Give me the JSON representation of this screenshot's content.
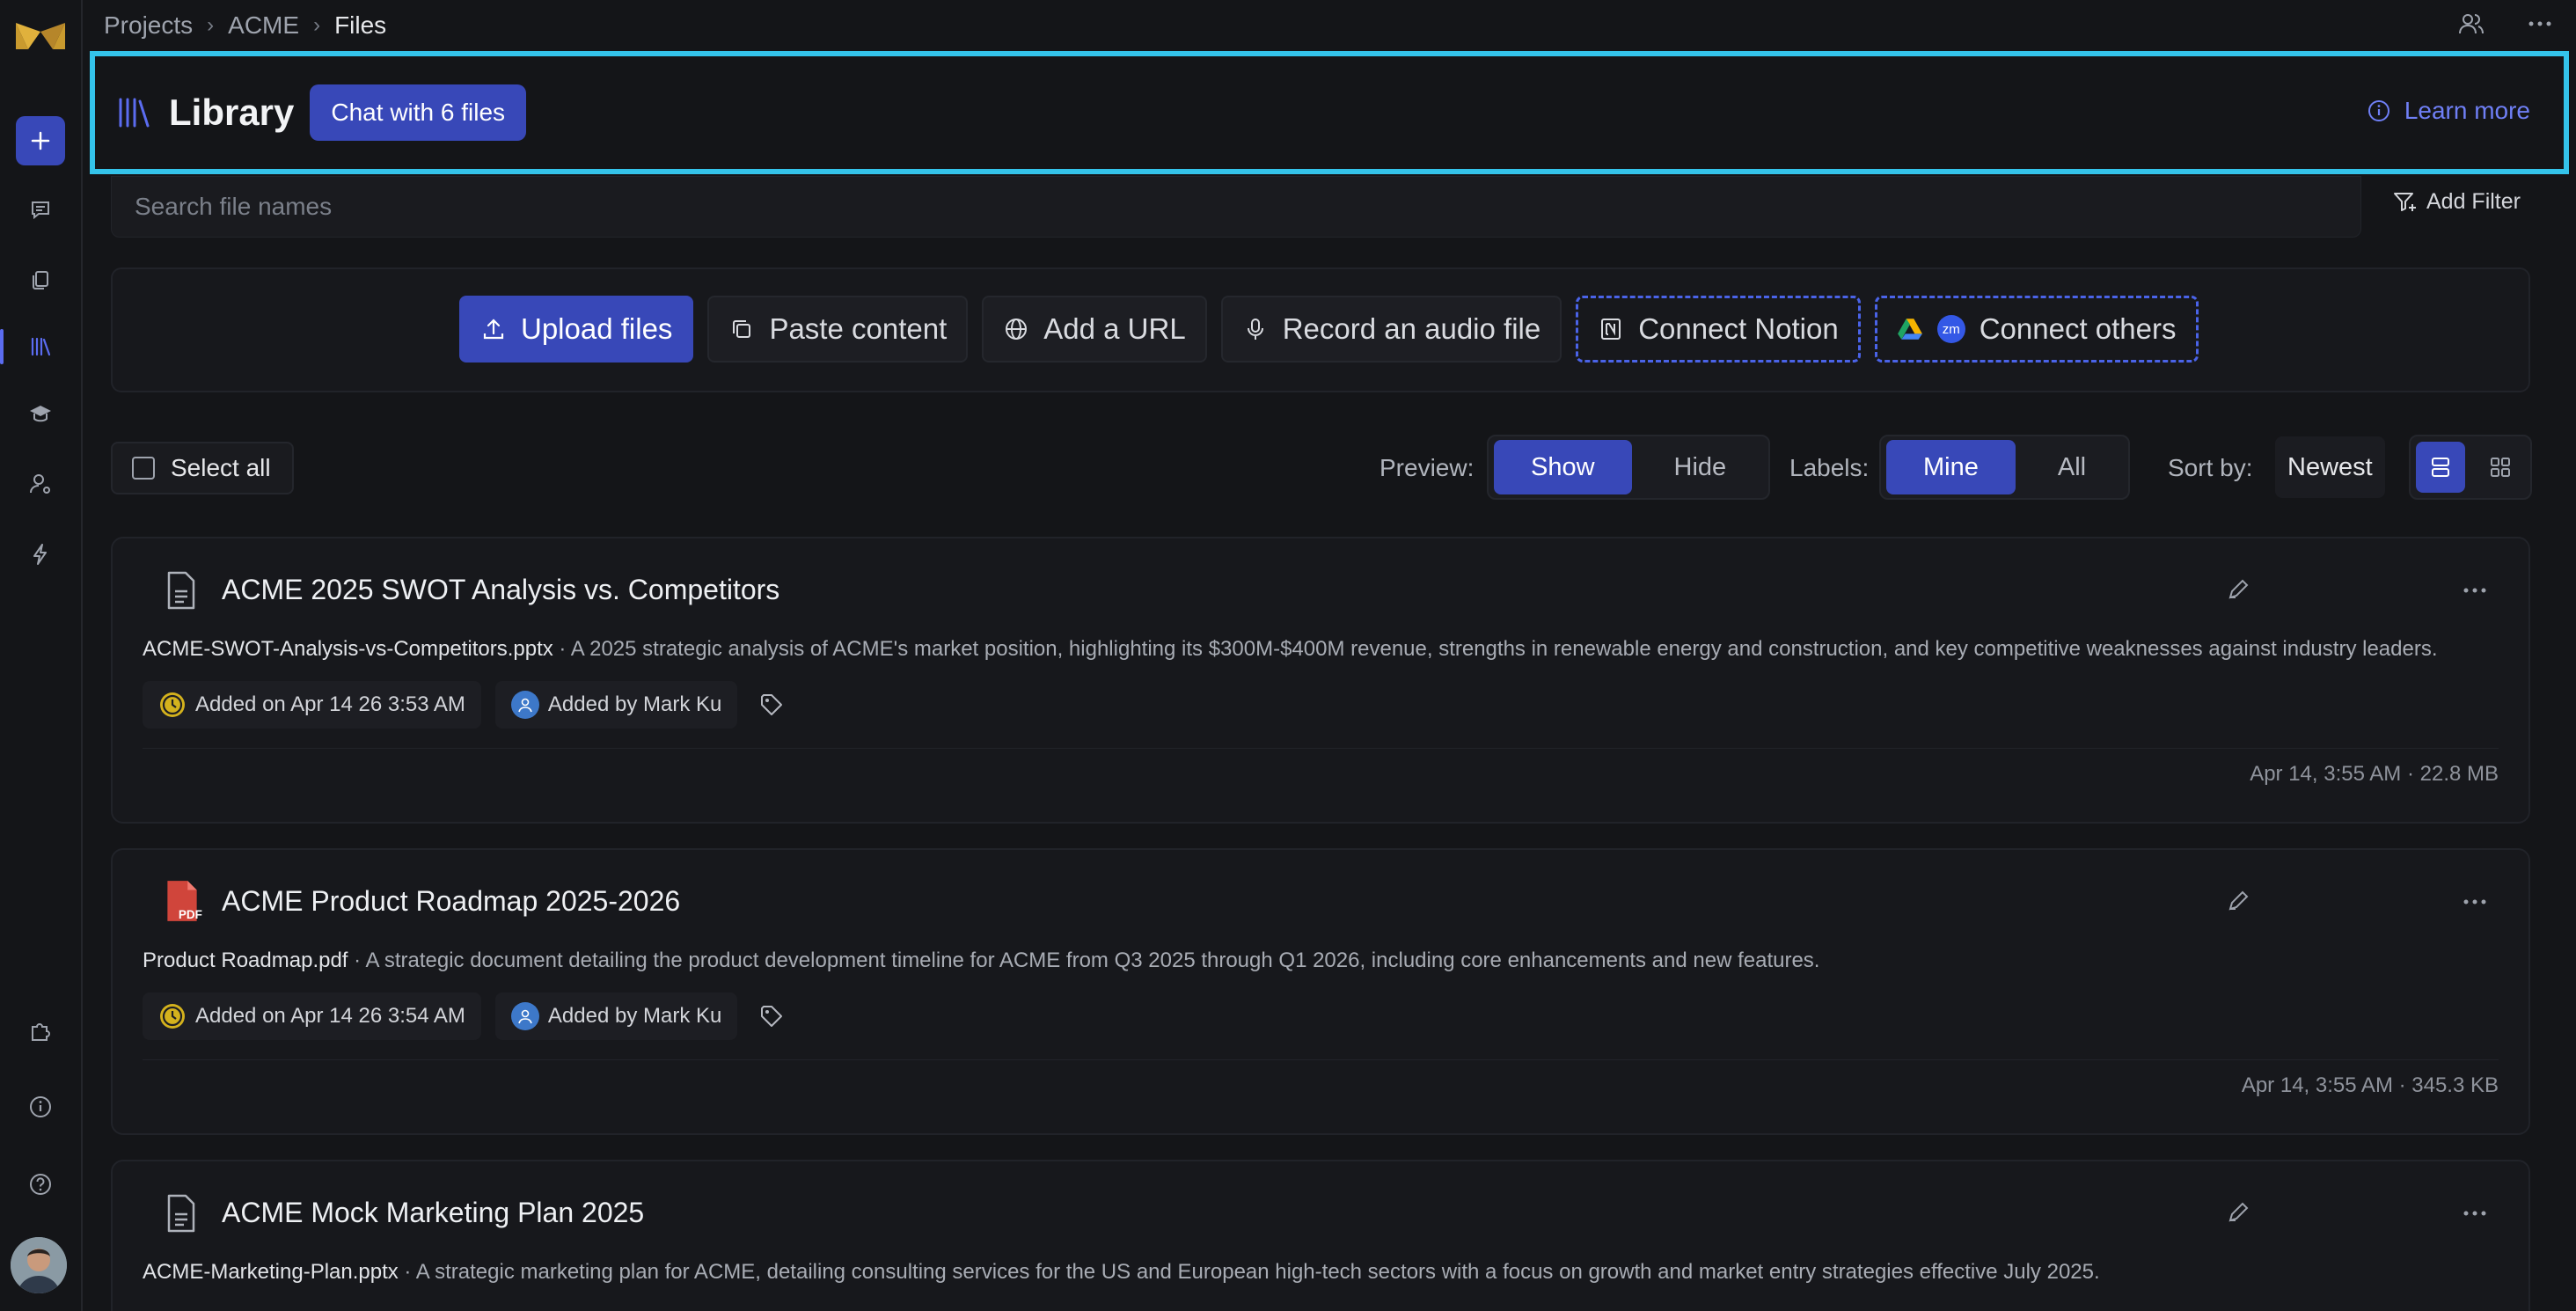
{
  "breadcrumb": {
    "items": [
      "Projects",
      "ACME",
      "Files"
    ]
  },
  "library": {
    "title": "Library",
    "chat_button": "Chat with 6 files",
    "learn_more": "Learn more"
  },
  "search": {
    "placeholder": "Search file names"
  },
  "filter": {
    "add_filter": "Add Filter"
  },
  "upload_actions": {
    "upload": "Upload files",
    "paste": "Paste content",
    "url": "Add a URL",
    "audio": "Record an audio file",
    "notion": "Connect Notion",
    "others": "Connect others"
  },
  "controls": {
    "select_all": "Select all",
    "preview_label": "Preview:",
    "preview_options": [
      "Show",
      "Hide"
    ],
    "preview_selected": "Show",
    "labels_label": "Labels:",
    "labels_options": [
      "Mine",
      "All"
    ],
    "labels_selected": "Mine",
    "sort_label": "Sort by:",
    "sort_value": "Newest",
    "view_selected": "list"
  },
  "files": [
    {
      "title": "ACME 2025 SWOT Analysis vs. Competitors",
      "filename": "ACME-SWOT-Analysis-vs-Competitors.pptx",
      "description": " · A 2025 strategic analysis of ACME's market position, highlighting its $300M-$400M revenue, strengths in renewable energy and construction, and key competitive weaknesses against industry leaders.",
      "added_on": "Added on Apr 14 26 3:53 AM",
      "added_by": "Added by Mark Ku",
      "meta": "Apr 14, 3:55 AM · 22.8 MB",
      "icon": "document-icon"
    },
    {
      "title": "ACME Product Roadmap 2025-2026",
      "filename": "Product Roadmap.pdf",
      "description": " · A strategic document detailing the product development timeline for ACME from Q3 2025 through Q1 2026, including core enhancements and new features.",
      "added_on": "Added on Apr 14 26 3:54 AM",
      "added_by": "Added by Mark Ku",
      "meta": "Apr 14, 3:55 AM · 345.3 KB",
      "icon": "pdf-icon"
    },
    {
      "title": "ACME Mock Marketing Plan 2025",
      "filename": "ACME-Marketing-Plan.pptx",
      "description": " · A strategic marketing plan for ACME, detailing consulting services for the US and European high-tech sectors with a focus on growth and market entry strategies effective July 2025.",
      "icon": "document-icon"
    }
  ],
  "colors": {
    "accent": "#3848b8",
    "highlight_border": "#34c3ea",
    "link": "#6f7ff5",
    "clock": "#d4b21d",
    "pdf": "#d0453b"
  }
}
